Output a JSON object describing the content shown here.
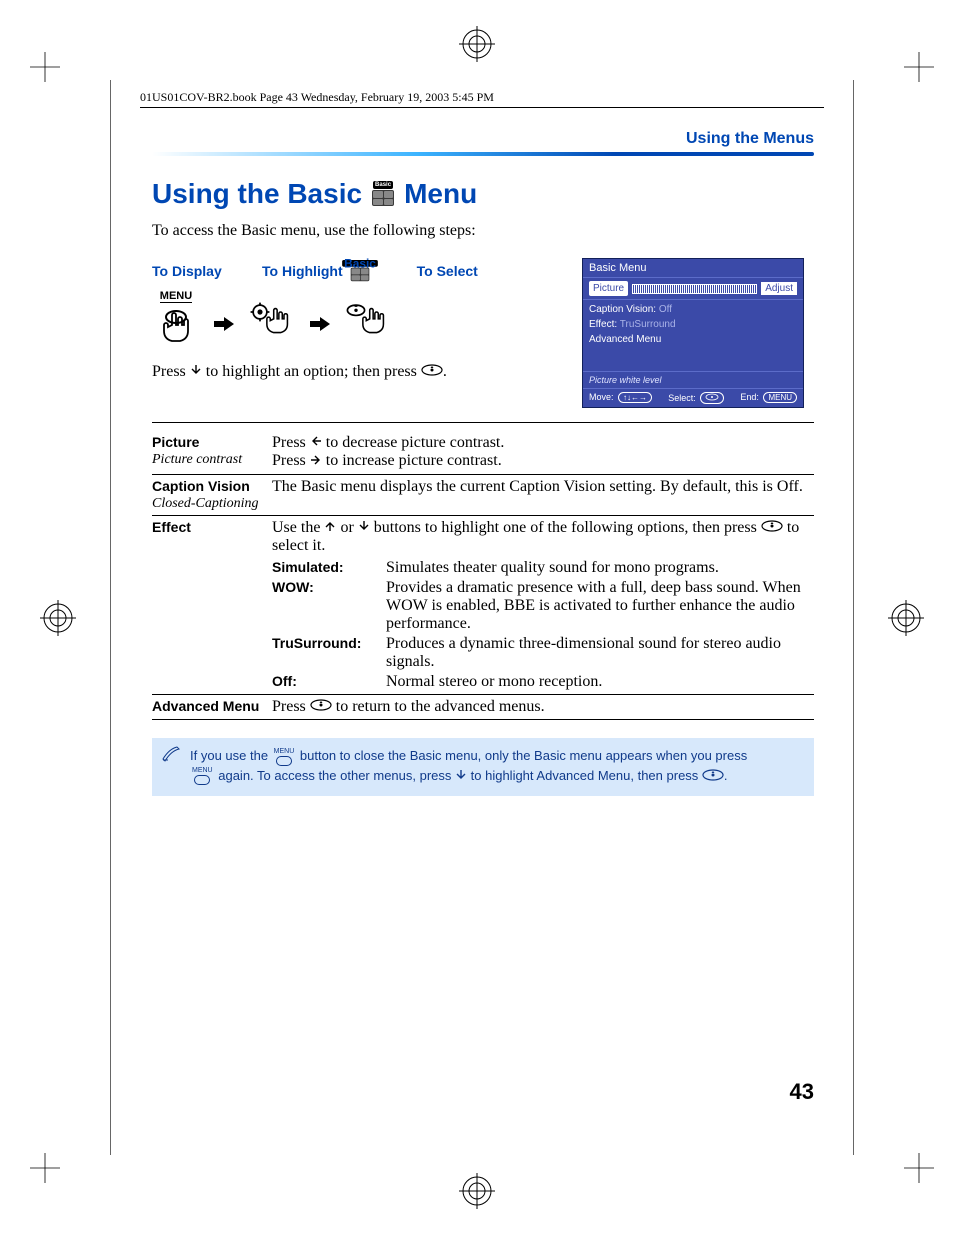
{
  "header": {
    "runner": "01US01COV-BR2.book  Page 43  Wednesday, February 19, 2003  5:45 PM"
  },
  "section_header": "Using the Menus",
  "title_pre": "Using the Basic",
  "title_post": "Menu",
  "basic_icon_label": "Basic",
  "intro": "To access the Basic menu, use the following steps:",
  "steps": {
    "display": "To Display",
    "highlight": "To Highlight",
    "select": "To Select",
    "menu_label": "MENU"
  },
  "press_line_pre": "Press ",
  "press_line_mid": " to highlight an option; then press ",
  "press_line_post": ".",
  "osd": {
    "title": "Basic Menu",
    "picture": "Picture",
    "adjust": "Adjust",
    "cv_label": "Caption Vision:",
    "cv_value": "Off",
    "eff_label": "Effect:",
    "eff_value": "TruSurround",
    "adv": "Advanced Menu",
    "hint": "Picture white level",
    "move": "Move:",
    "move_glyphs": "↑↓←→",
    "select": "Select:",
    "end": "End:",
    "end_glyph": "MENU"
  },
  "defs": {
    "picture": {
      "term": "Picture",
      "sub": "Picture contrast",
      "line1_pre": "Press ",
      "line1_post": " to decrease picture contrast.",
      "line2_pre": "Press ",
      "line2_post": " to increase picture contrast."
    },
    "caption": {
      "term": "Caption Vision",
      "sub": "Closed-Captioning",
      "desc": "The Basic menu displays the current Caption Vision setting. By default, this is Off."
    },
    "effect": {
      "term": "Effect",
      "intro_pre": "Use the ",
      "intro_mid": " or ",
      "intro_mid2": " buttons to highlight one of the following options, then press ",
      "intro_post": " to select it.",
      "rows": {
        "simulated_k": "Simulated:",
        "simulated_v": "Simulates theater quality sound for mono programs.",
        "wow_k": "WOW:",
        "wow_v": "Provides a dramatic presence with a full, deep bass sound. When WOW is enabled, BBE is activated to further enhance the audio performance.",
        "tru_k": "TruSurround:",
        "tru_v": "Produces a dynamic three-dimensional sound for stereo audio signals.",
        "off_k": "Off:",
        "off_v": "Normal stereo or mono reception."
      }
    },
    "adv": {
      "term": "Advanced Menu",
      "pre": "Press ",
      "post": " to return to the advanced menus."
    }
  },
  "note": {
    "l1_pre": "If you use the ",
    "l1_post": " button to close the Basic menu, only the Basic menu appears when you press",
    "l2_pre": "",
    "l2_mid": " again. To access the other menus, press ",
    "l2_mid2": " to highlight Advanced Menu, then press ",
    "l2_post": "."
  },
  "page_number": "43"
}
